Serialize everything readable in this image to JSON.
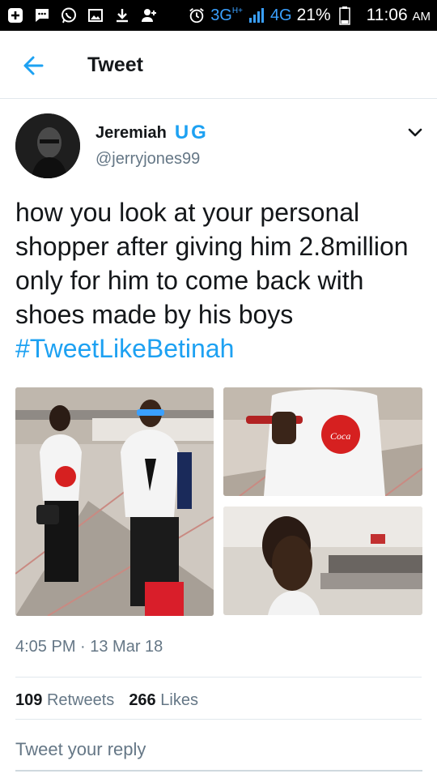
{
  "status_bar": {
    "network": "3G",
    "network_sup": "H+",
    "network2": "4G",
    "battery": "21%",
    "time": "11:06",
    "ampm": "AM",
    "icons": [
      "plus-box-icon",
      "message-icon",
      "whatsapp-icon",
      "image-icon",
      "download-icon",
      "add-user-icon",
      "alarm-icon",
      "signal-icon",
      "battery-icon"
    ]
  },
  "app_bar": {
    "title": "Tweet",
    "back_icon": "back-arrow-icon"
  },
  "tweet": {
    "author_name": "Jeremiah",
    "author_badge": "UG",
    "handle": "@jerryjones99",
    "text_plain": "how you look at your personal shopper after giving him 2.8million only for him to come back with shoes made by his boys ",
    "hashtag": "#TweetLikeBetinah",
    "timestamp": "4:05 PM · 13 Mar 18",
    "retweets_count": "109",
    "retweets_label": "Retweets",
    "likes_count": "266",
    "likes_label": "Likes"
  },
  "reply": {
    "placeholder": "Tweet your reply"
  },
  "colors": {
    "accent": "#1da1f2",
    "secondary_text": "#657786",
    "primary_text": "#14171a",
    "divider": "#e1e8ed"
  }
}
